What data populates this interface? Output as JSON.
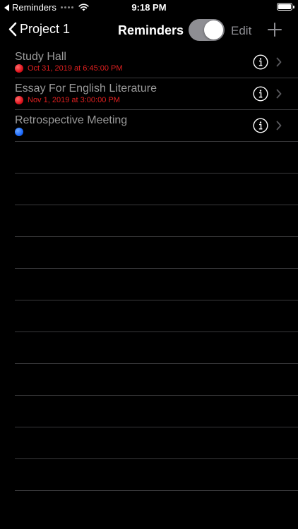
{
  "status_bar": {
    "back_label": "Reminders",
    "time": "9:18 PM"
  },
  "nav": {
    "back_label": "Project 1",
    "title": "Reminders",
    "toggle_on": true,
    "edit_label": "Edit"
  },
  "colors": {
    "date_red": "#e02020",
    "dot_red": "#e0141e",
    "dot_blue": "#1d6cff",
    "toggle_track": "#8e8e93"
  },
  "reminders": [
    {
      "title": "Study Hall",
      "date": "Oct 31, 2019 at 6:45:00 PM",
      "dot_color": "#e0141e"
    },
    {
      "title": "Essay For English Literature",
      "date": "Nov 1, 2019 at 3:00:00 PM",
      "dot_color": "#e0141e"
    },
    {
      "title": "Retrospective Meeting",
      "date": "",
      "dot_color": "#1d6cff"
    }
  ],
  "empty_rows": 11
}
